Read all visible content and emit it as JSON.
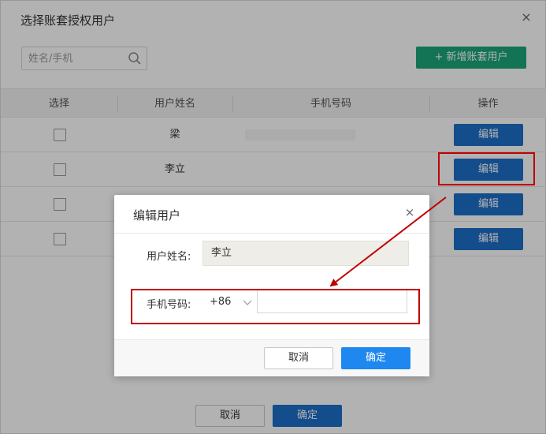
{
  "window": {
    "title": "选择账套授权用户",
    "close_glyph": "×"
  },
  "search": {
    "placeholder": "姓名/手机"
  },
  "toolbar": {
    "add_user_label": "+ 新增账套用户",
    "add_color": "#1aa679"
  },
  "table": {
    "headers": [
      "选择",
      "用户姓名",
      "手机号码",
      "操作"
    ],
    "rows": [
      {
        "name": "梁",
        "phone": "",
        "action": "编辑"
      },
      {
        "name": "李立",
        "phone": "",
        "action": "编辑"
      },
      {
        "name": "",
        "phone": "",
        "action": "编辑"
      },
      {
        "name": "",
        "phone": "",
        "action": "编辑"
      }
    ]
  },
  "footer": {
    "cancel_label": "取消",
    "ok_label": "确定"
  },
  "modal": {
    "title": "编辑用户",
    "close_glyph": "×",
    "name_label": "用户姓名:",
    "name_value": "李立",
    "phone_label": "手机号码:",
    "country_code": "+86",
    "phone_value": "",
    "cancel_label": "取消",
    "ok_label": "确定"
  },
  "colors": {
    "primary": "#1e6fc9",
    "modal_primary": "#1e88f0",
    "annotation": "#c00000"
  }
}
